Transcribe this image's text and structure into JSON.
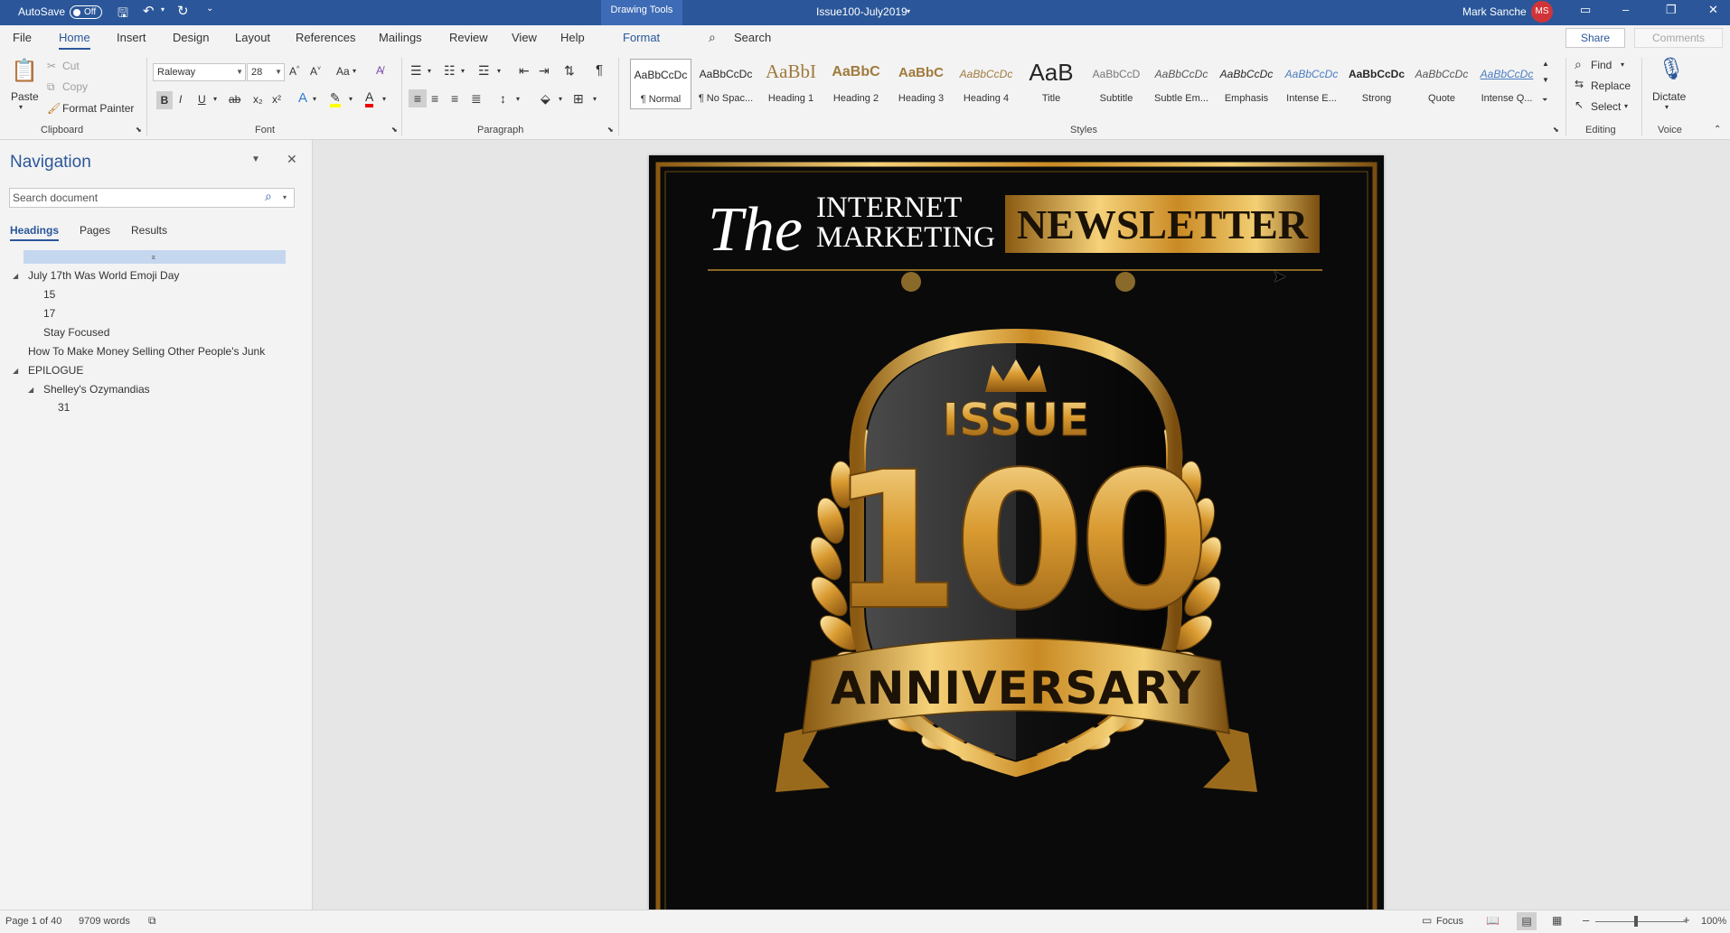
{
  "titlebar": {
    "autosave_label": "AutoSave",
    "autosave_state": "Off",
    "contextual_tab": "Drawing Tools",
    "doc_title": "Issue100-July2019",
    "user_name": "Mark Sanche",
    "user_initials": "MS",
    "accent_color": "#2b579a"
  },
  "tabs": [
    "File",
    "Home",
    "Insert",
    "Design",
    "Layout",
    "References",
    "Mailings",
    "Review",
    "View",
    "Help"
  ],
  "format_tab": "Format",
  "tell_me": "Search",
  "share_label": "Share",
  "comments_label": "Comments",
  "ribbon": {
    "clipboard": {
      "paste": "Paste",
      "cut": "Cut",
      "copy": "Copy",
      "format_painter": "Format Painter",
      "label": "Clipboard"
    },
    "font": {
      "name": "Raleway",
      "size": "28",
      "label": "Font",
      "bold": "B",
      "italic": "I",
      "underline": "U",
      "strike": "ab",
      "sub": "x₂",
      "sup": "x²",
      "grow": "A^",
      "shrink": "A˅",
      "case": "Aa"
    },
    "paragraph": {
      "label": "Paragraph",
      "pilcrow": "¶"
    },
    "styles": {
      "label": "Styles",
      "items": [
        {
          "preview": "AaBbCcDc",
          "name": "¶ Normal"
        },
        {
          "preview": "AaBbCcDc",
          "name": "¶ No Spac..."
        },
        {
          "preview": "AaBbI",
          "name": "Heading 1"
        },
        {
          "preview": "AaBbC",
          "name": "Heading 2"
        },
        {
          "preview": "AaBbC",
          "name": "Heading 3"
        },
        {
          "preview": "AaBbCcDc",
          "name": "Heading 4"
        },
        {
          "preview": "AaB",
          "name": "Title"
        },
        {
          "preview": "AaBbCcD",
          "name": "Subtitle"
        },
        {
          "preview": "AaBbCcDc",
          "name": "Subtle Em..."
        },
        {
          "preview": "AaBbCcDc",
          "name": "Emphasis"
        },
        {
          "preview": "AaBbCcDc",
          "name": "Intense E..."
        },
        {
          "preview": "AaBbCcDc",
          "name": "Strong"
        },
        {
          "preview": "AaBbCcDc",
          "name": "Quote"
        },
        {
          "preview": "AaBbCcDc",
          "name": "Intense Q..."
        }
      ]
    },
    "editing": {
      "label": "Editing",
      "find": "Find",
      "replace": "Replace",
      "select": "Select"
    },
    "voice": {
      "label": "Voice",
      "dictate": "Dictate"
    }
  },
  "navigation": {
    "title": "Navigation",
    "search_placeholder": "Search document",
    "tabs": [
      "Headings",
      "Pages",
      "Results"
    ],
    "headings": [
      {
        "text": "July 17th Was World Emoji Day",
        "level": 1
      },
      {
        "text": "15",
        "level": 2
      },
      {
        "text": "17",
        "level": 2
      },
      {
        "text": "Stay Focused",
        "level": 2
      },
      {
        "text": "How To Make Money Selling Other People's Junk",
        "level": 1
      },
      {
        "text": "EPILOGUE",
        "level": 1
      },
      {
        "text": "Shelley's Ozymandias",
        "level": 2
      },
      {
        "text": "31",
        "level": 3
      }
    ]
  },
  "document": {
    "masthead_script": "The",
    "masthead_line1": "INTERNET",
    "masthead_line2": "MARKETING",
    "masthead_banner": "NEWSLETTER",
    "badge_issue": "ISSUE",
    "badge_number": "100",
    "badge_ribbon": "ANNIVERSARY",
    "gold": "#d9a441"
  },
  "status": {
    "page": "Page 1 of 40",
    "words": "9709 words",
    "focus": "Focus",
    "zoom": "100%"
  }
}
